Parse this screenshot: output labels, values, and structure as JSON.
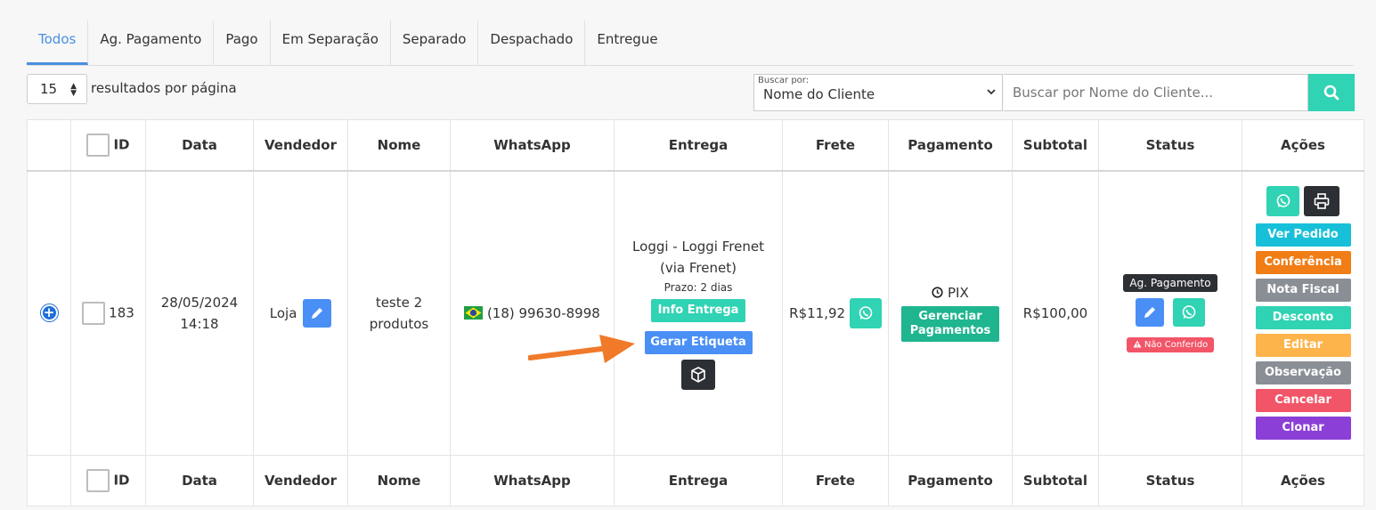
{
  "tabs": [
    "Todos",
    "Ag. Pagamento",
    "Pago",
    "Em Separação",
    "Separado",
    "Despachado",
    "Entregue"
  ],
  "toolbar": {
    "per_page_value": "15",
    "per_page_label": "resultados por página",
    "search_by_label": "Buscar por:",
    "search_by_value": "Nome do Cliente",
    "search_placeholder": "Buscar por Nome do Cliente..."
  },
  "columns": [
    "ID",
    "Data",
    "Vendedor",
    "Nome",
    "WhatsApp",
    "Entrega",
    "Frete",
    "Pagamento",
    "Subtotal",
    "Status",
    "Ações"
  ],
  "order": {
    "id": "183",
    "date_line1": "28/05/2024",
    "date_line2": "14:18",
    "vendedor": "Loja",
    "nome_line1": "teste 2",
    "nome_line2": "produtos",
    "whatsapp": "(18) 99630-8998",
    "entrega_line1": "Loggi - Loggi Frenet",
    "entrega_line2": "(via Frenet)",
    "prazo": "Prazo: 2 dias",
    "info_entrega": "Info Entrega",
    "gerar_etiqueta": "Gerar Etiqueta",
    "frete": "R$11,92",
    "pagamento_metodo": "PIX",
    "gerenciar_line1": "Gerenciar",
    "gerenciar_line2": "Pagamentos",
    "subtotal": "R$100,00",
    "status": "Ag. Pagamento",
    "nao_conferido": "Não Conferido"
  },
  "actions": [
    {
      "label": "Ver Pedido",
      "color": "#17c0d8"
    },
    {
      "label": "Conferência",
      "color": "#f07d16"
    },
    {
      "label": "Nota Fiscal",
      "color": "#8a8f96"
    },
    {
      "label": "Desconto",
      "color": "#30d3b3"
    },
    {
      "label": "Editar",
      "color": "#fdb44b"
    },
    {
      "label": "Observação",
      "color": "#8a8f96"
    },
    {
      "label": "Cancelar",
      "color": "#f25567"
    },
    {
      "label": "Clonar",
      "color": "#8b3fd6"
    }
  ],
  "colors": {
    "accent": "#4a8fe0",
    "teal": "#30d3b3",
    "blue": "#4a8ff5",
    "green": "#1fb58f",
    "dark": "#2c2f33",
    "arrow": "#f07a2a"
  }
}
